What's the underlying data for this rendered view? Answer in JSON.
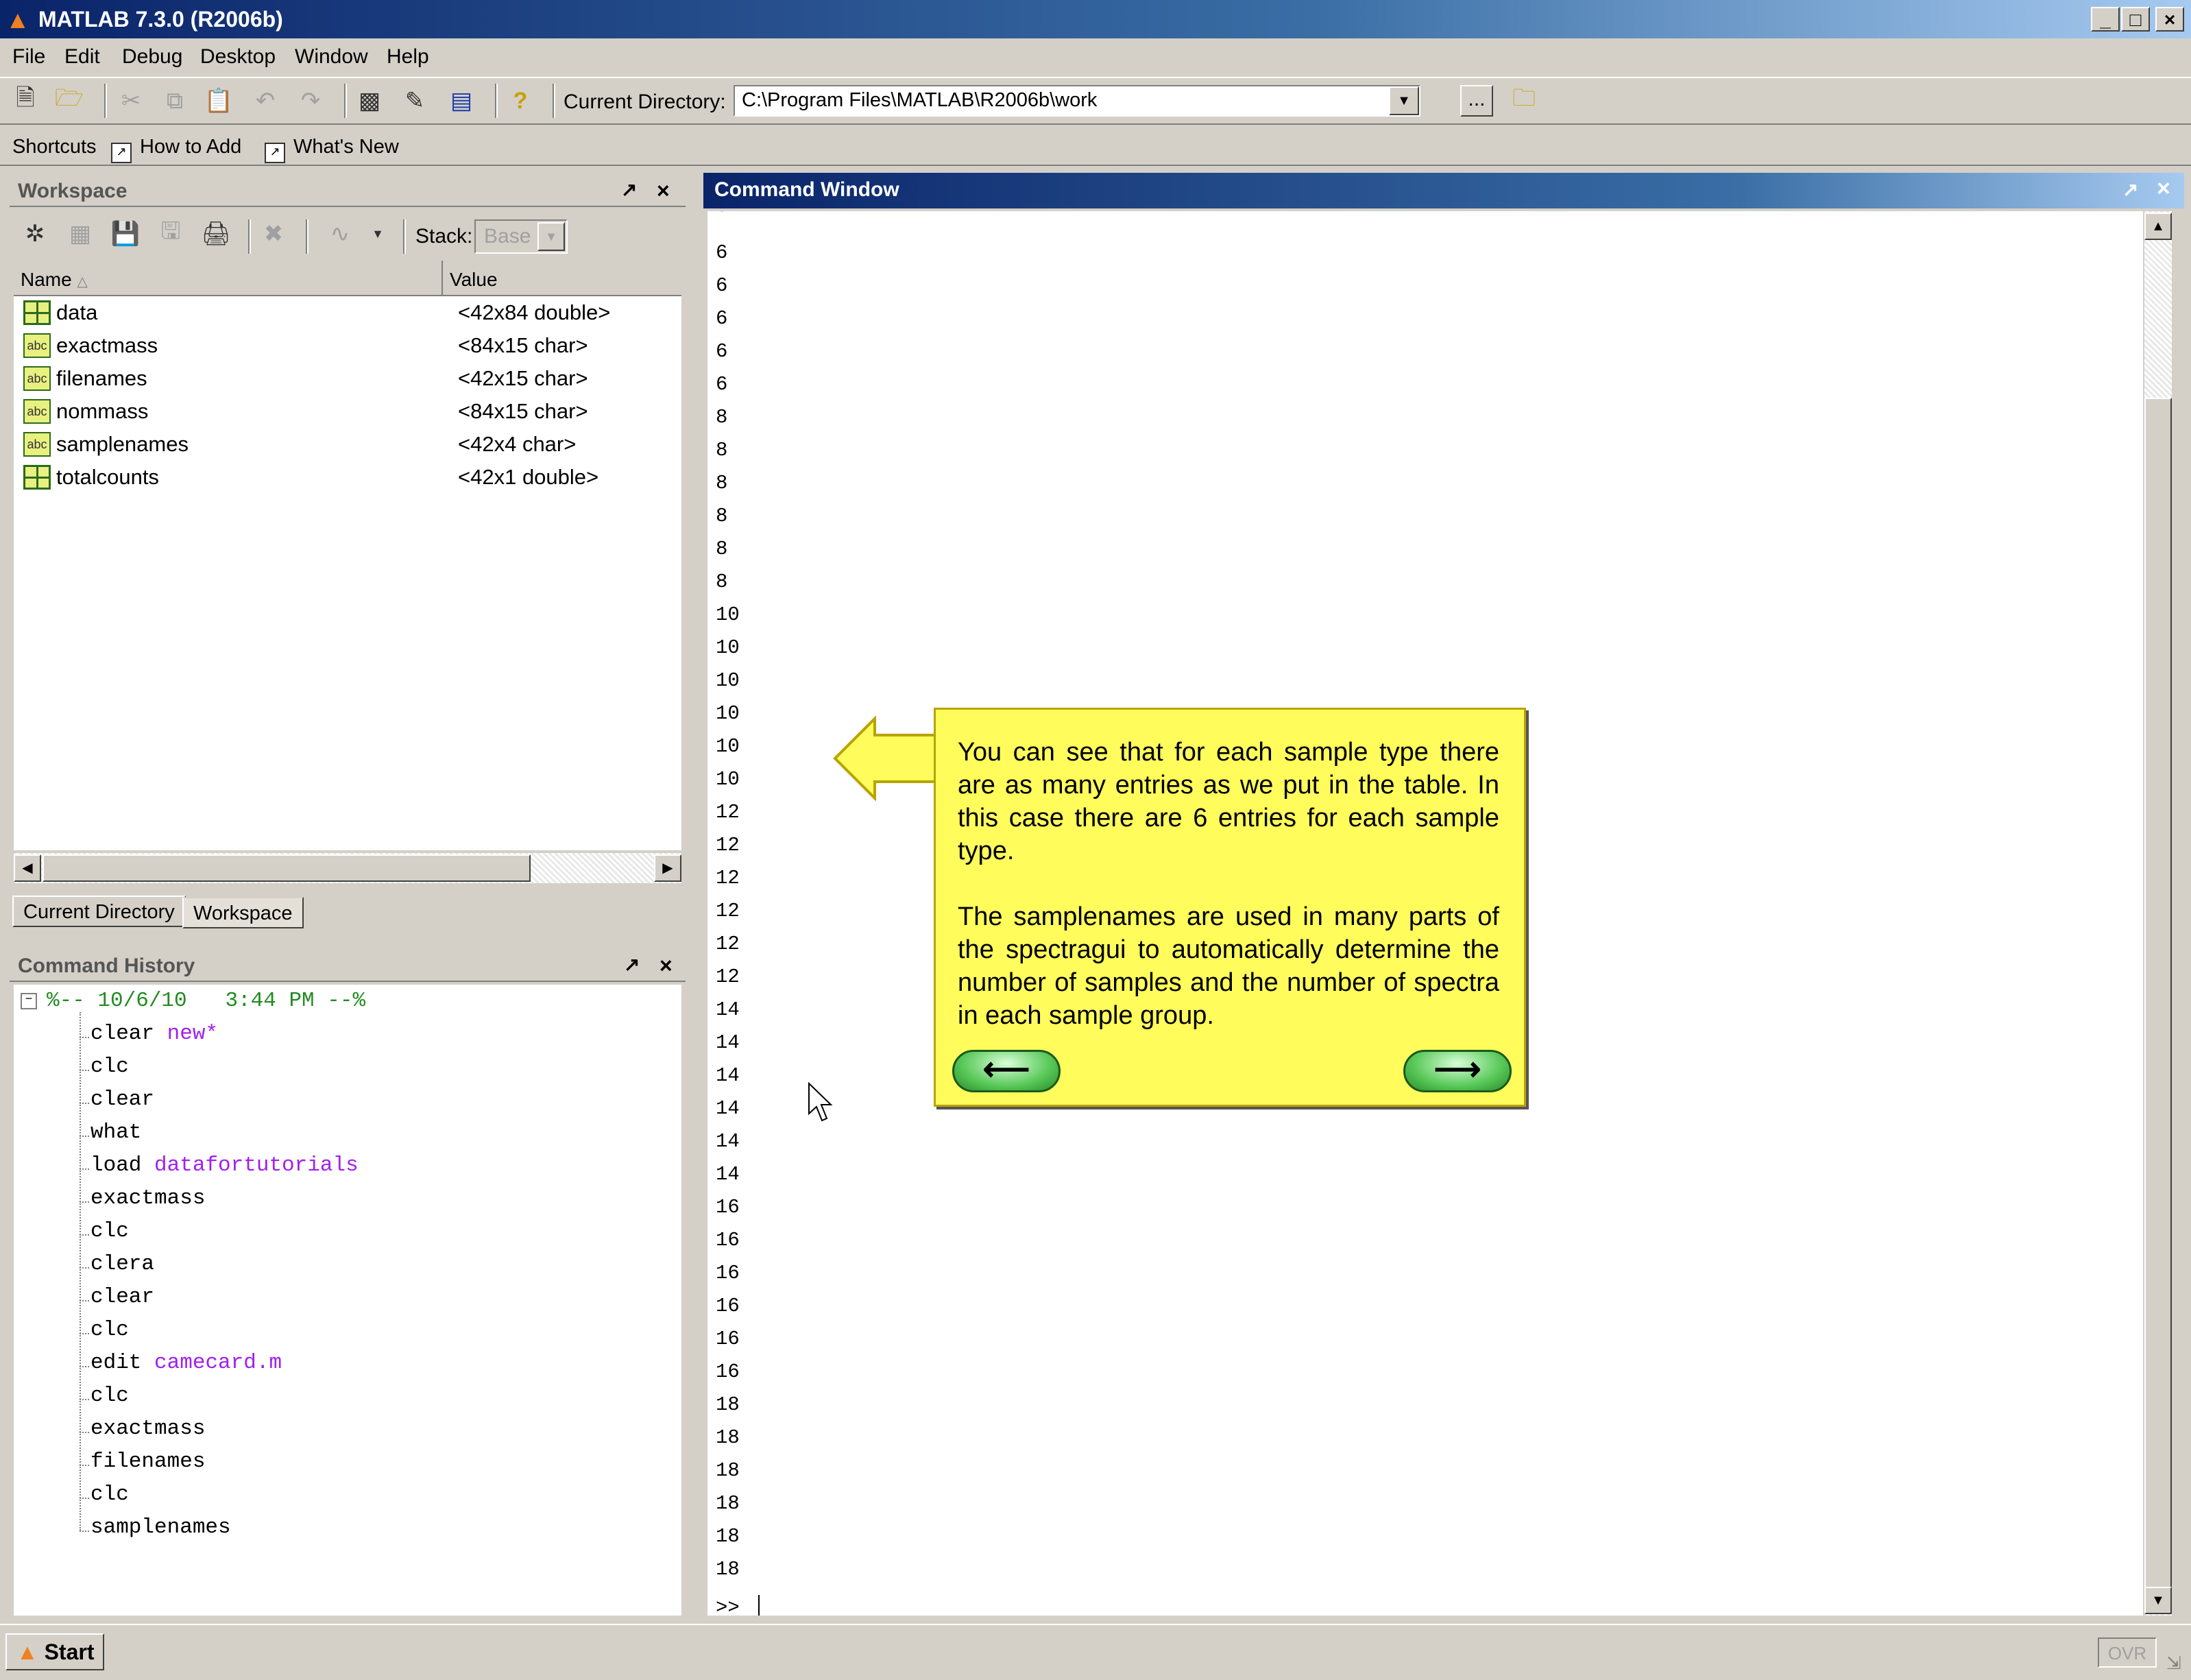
{
  "window": {
    "title": "MATLAB 7.3.0 (R2006b)"
  },
  "menu": [
    "File",
    "Edit",
    "Debug",
    "Desktop",
    "Window",
    "Help"
  ],
  "toolbar": {
    "current_directory_label": "Current Directory:",
    "current_directory_value": "C:\\Program Files\\MATLAB\\R2006b\\work",
    "browse_label": "...",
    "icons": [
      "new-file-icon",
      "open-icon",
      "cut-icon",
      "copy-icon",
      "paste-icon",
      "undo-icon",
      "redo-icon",
      "simulink-icon",
      "guide-icon",
      "profiler-icon",
      "help-icon"
    ]
  },
  "shortcuts": {
    "label": "Shortcuts",
    "how_to_add": "How to Add",
    "whats_new": "What's New"
  },
  "workspace": {
    "title": "Workspace",
    "stack_label": "Stack:",
    "stack_value": "Base",
    "columns": {
      "name": "Name",
      "value": "Value"
    },
    "variables": [
      {
        "name": "data",
        "value": "<42x84 double>",
        "type": "double"
      },
      {
        "name": "exactmass",
        "value": "<84x15 char>",
        "type": "char"
      },
      {
        "name": "filenames",
        "value": "<42x15 char>",
        "type": "char"
      },
      {
        "name": "nommass",
        "value": "<84x15 char>",
        "type": "char"
      },
      {
        "name": "samplenames",
        "value": "<42x4 char>",
        "type": "char"
      },
      {
        "name": "totalcounts",
        "value": "<42x1 double>",
        "type": "double"
      }
    ]
  },
  "tabs": {
    "current_directory": "Current Directory",
    "workspace": "Workspace"
  },
  "history": {
    "title": "Command History",
    "session": "%-- 10/6/10   3:44 PM --%",
    "commands": [
      {
        "cmd": "clear",
        "arg": "new*"
      },
      {
        "cmd": "clc",
        "arg": ""
      },
      {
        "cmd": "clear",
        "arg": ""
      },
      {
        "cmd": "what",
        "arg": ""
      },
      {
        "cmd": "load",
        "arg": "datafortutorials"
      },
      {
        "cmd": "exactmass",
        "arg": ""
      },
      {
        "cmd": "clc",
        "arg": ""
      },
      {
        "cmd": "clera",
        "arg": ""
      },
      {
        "cmd": "clear",
        "arg": ""
      },
      {
        "cmd": "clc",
        "arg": ""
      },
      {
        "cmd": "edit",
        "arg": "camecard.m"
      },
      {
        "cmd": "clc",
        "arg": ""
      },
      {
        "cmd": "exactmass",
        "arg": ""
      },
      {
        "cmd": "filenames",
        "arg": ""
      },
      {
        "cmd": "clc",
        "arg": ""
      },
      {
        "cmd": "samplenames",
        "arg": ""
      }
    ]
  },
  "command_window": {
    "title": "Command Window",
    "output": [
      "6",
      "6",
      "6",
      "6",
      "6",
      "8",
      "8",
      "8",
      "8",
      "8",
      "8",
      "10",
      "10",
      "10",
      "10",
      "10",
      "10",
      "12",
      "12",
      "12",
      "12",
      "12",
      "12",
      "14",
      "14",
      "14",
      "14",
      "14",
      "14",
      "16",
      "16",
      "16",
      "16",
      "16",
      "16",
      "18",
      "18",
      "18",
      "18",
      "18",
      "18"
    ],
    "prompt": ">>"
  },
  "callout": {
    "paragraph1": "You can see that for each sample type there are as many entries as we put in the table.  In this case there are 6 entries for each sample type.",
    "paragraph2": "The samplenames are used in many parts of the spectragui to automatically determine the number of samples and the number of spectra in each sample group."
  },
  "status": {
    "start": "Start",
    "ovr": "OVR"
  }
}
